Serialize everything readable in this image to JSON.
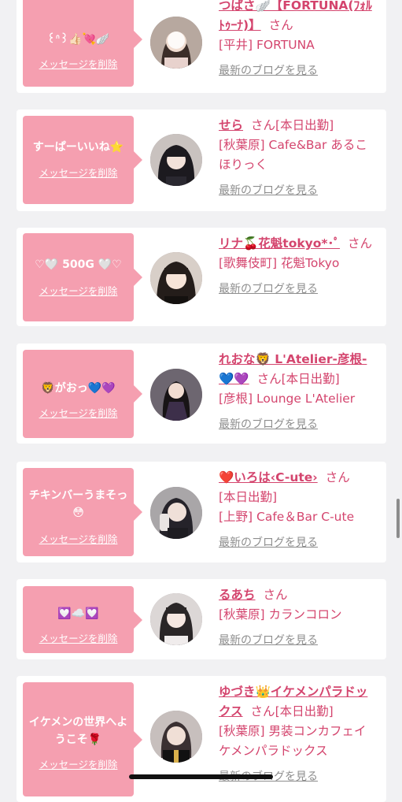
{
  "delete_label": "メッセージを削除",
  "blog_label": "最新のブログを見る",
  "san_label": "さん",
  "colors": {
    "bubble": "#f59fb0",
    "name": "#d4456e",
    "muted": "#8e8e8e",
    "background": "#f1f1f3"
  },
  "cards": [
    {
      "message": "꒰ᐢ꒱👍🏻💘🪽",
      "name": "つばさ🪽【FORTUNA(ﾌｫﾙﾄｩｰﾅ)】",
      "status": "",
      "shop": "[平井] FORTUNA"
    },
    {
      "message": "すーぱーいいね⭐",
      "name": "せら",
      "status": "[本日出勤]",
      "shop": "[秋葉原] Cafe&Bar あるこほりっく"
    },
    {
      "message": "♡🤍 500G 🤍♡",
      "name": "リナ🍒花魁tokyo*･ﾟ",
      "status": "",
      "shop": "[歌舞伎町] 花魁Tokyo"
    },
    {
      "message": "🦁がおっ💙💜",
      "name": "れおな🦁 L'Atelier-彦根-💙💜",
      "status": "[本日出勤]",
      "shop": "[彦根] Lounge L'Atelier"
    },
    {
      "message": "チキンバーうまそっ😳",
      "name": "❤️いろは‹C-ute›",
      "status": "[本日出勤]",
      "shop": "[上野] Cafe＆Bar C-ute"
    },
    {
      "message": "💟☁️💟",
      "name": "るあち",
      "status": "",
      "shop": "[秋葉原] カランコロン"
    },
    {
      "message": "イケメンの世界へようこそ🌹",
      "name": "ゆづき👑イケメンパラドックス",
      "status": "[本日出勤]",
      "shop": "[秋葉原] 男装コンカフェイケメンパラドックス"
    }
  ]
}
